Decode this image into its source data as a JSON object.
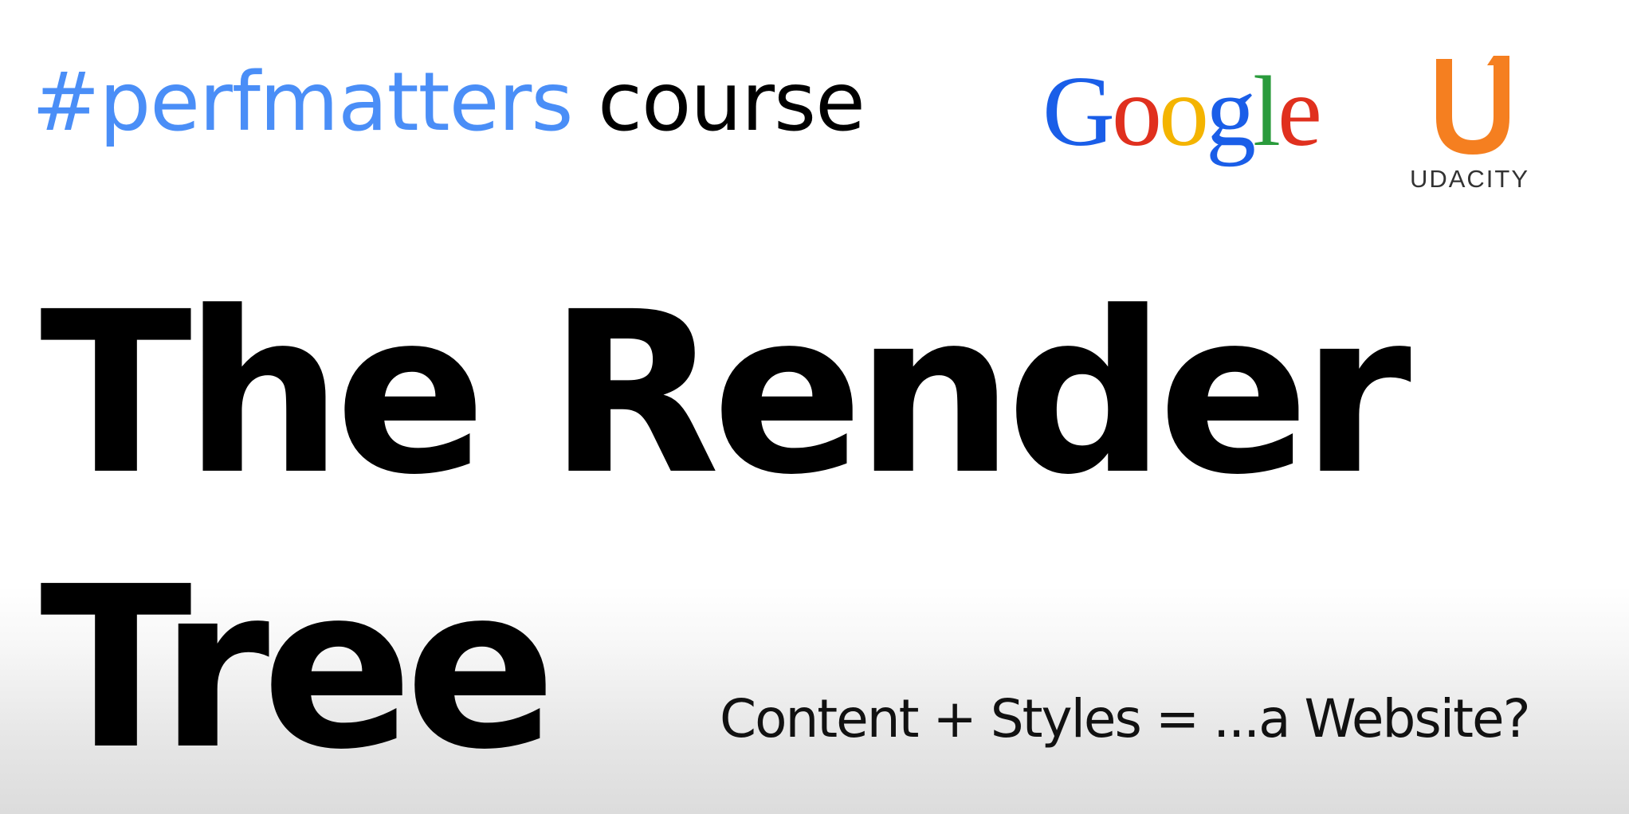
{
  "header": {
    "hashtag": "#perfmatters",
    "course_label": "course"
  },
  "logos": {
    "google": {
      "letters": [
        "G",
        "o",
        "o",
        "g",
        "l",
        "e"
      ],
      "colors": [
        "#1a5ee8",
        "#e0301e",
        "#f4b400",
        "#1a5ee8",
        "#2a9b3c",
        "#e0301e"
      ]
    },
    "udacity": {
      "text": "UDACITY",
      "color": "#f57f20"
    }
  },
  "title": {
    "line1": "The Render",
    "line2": "Tree"
  },
  "subtitle": "Content + Styles = ...a Website?"
}
